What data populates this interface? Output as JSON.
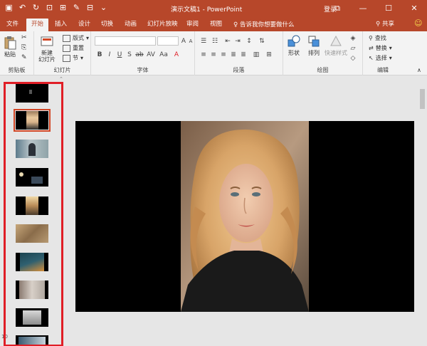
{
  "app": {
    "title": "演示文稿1 - PowerPoint",
    "login": "登录"
  },
  "tabs": [
    {
      "label": "文件"
    },
    {
      "label": "开始"
    },
    {
      "label": "插入"
    },
    {
      "label": "设计"
    },
    {
      "label": "切换"
    },
    {
      "label": "动画"
    },
    {
      "label": "幻灯片放映"
    },
    {
      "label": "审阅"
    },
    {
      "label": "视图"
    }
  ],
  "tellme": "告诉我你想要做什么",
  "share": "共享",
  "ribbon": {
    "clipboard": {
      "label": "剪贴板",
      "paste": "粘贴"
    },
    "slides": {
      "label": "幻灯片",
      "new_slide": "新建\n幻灯片",
      "layout": "版式",
      "reset": "重置",
      "section": "节"
    },
    "font": {
      "label": "字体"
    },
    "paragraph": {
      "label": "段落"
    },
    "drawing": {
      "label": "绘图",
      "shapes": "形状",
      "arrange": "排列",
      "quick_styles": "快速样式"
    },
    "editing": {
      "label": "编辑",
      "find": "查找",
      "replace": "替换",
      "select": "选择"
    }
  },
  "slides": [
    {
      "number": "1"
    },
    {
      "number": "2"
    },
    {
      "number": "3"
    },
    {
      "number": "4"
    },
    {
      "number": "5"
    },
    {
      "number": "6"
    },
    {
      "number": "7"
    },
    {
      "number": "8"
    },
    {
      "number": "9"
    },
    {
      "number": "10"
    }
  ],
  "colors": {
    "accent": "#b7472a",
    "highlight": "#e01e26"
  }
}
